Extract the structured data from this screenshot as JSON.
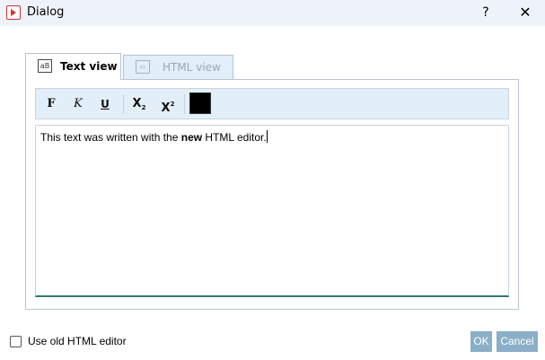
{
  "window": {
    "title": "Dialog",
    "help_label": "?",
    "close_label": "✕"
  },
  "tabs": [
    {
      "label": "Text view",
      "icon": "aB",
      "active": true
    },
    {
      "label": "HTML view",
      "icon": "‹›",
      "active": false
    }
  ],
  "toolbar": {
    "bold": "F",
    "italic": "K",
    "underline": "U",
    "subscript": "X",
    "subscript_mark": "2",
    "superscript": "X",
    "superscript_mark": "2",
    "text_color": "#000000"
  },
  "editor": {
    "text_before": "This text was written with the ",
    "text_bold": "new",
    "text_after": " HTML editor."
  },
  "footer": {
    "checkbox_label": "Use old HTML editor",
    "checkbox_checked": false,
    "ok_label": "OK",
    "cancel_label": "Cancel"
  },
  "colors": {
    "accent": "#d62f2f",
    "button_bg": "#8aafc8",
    "toolbar_bg": "#e2eef8"
  }
}
